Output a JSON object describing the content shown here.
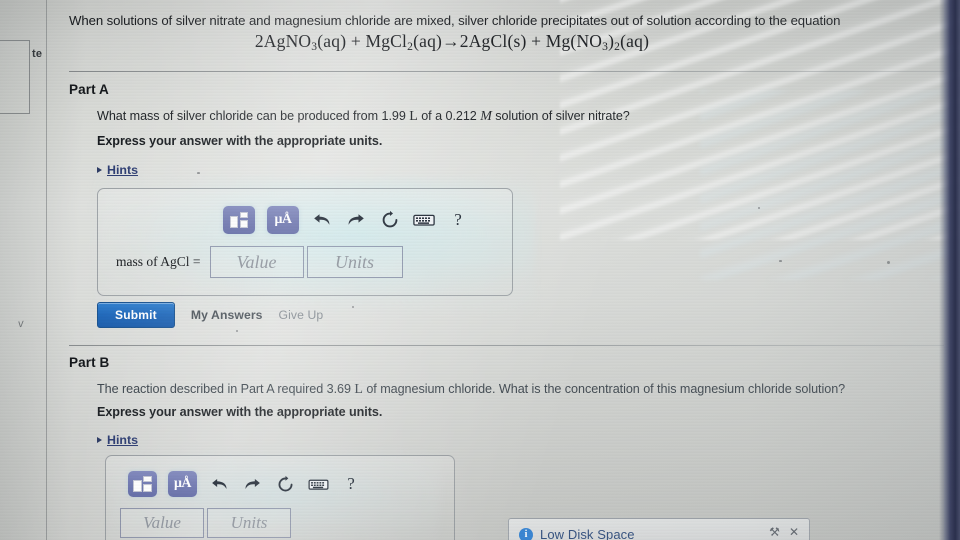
{
  "sidebar": {
    "fragment_label": "te",
    "scribble": "v"
  },
  "problem": {
    "prompt": "When solutions of silver nitrate and magnesium chloride are mixed, silver chloride precipitates out of solution according to the equation",
    "equation_plain": "2AgNO3(aq) + MgCl2(aq)→2AgCl(s) + Mg(NO3)2(aq)",
    "equation_parts": {
      "t1": "2AgNO",
      "s1": "3",
      "t2": "(aq) + MgCl",
      "s2": "2",
      "t3": "(aq)→2AgCl(s) + Mg(NO",
      "s3": "3",
      "t4": ")",
      "s4": "2",
      "t5": "(aq)"
    }
  },
  "part_a": {
    "heading": "Part A",
    "question_prefix": "What mass of silver chloride can be produced from ",
    "volume": "1.99",
    "volume_unit": "L",
    "question_mid": " of a ",
    "concentration": "0.212",
    "concentration_unit": "M",
    "question_suffix": " solution of silver nitrate?",
    "instruction": "Express your answer with the appropriate units.",
    "hints_label": "Hints",
    "answer_label": "mass of AgCl =",
    "value_placeholder": "Value",
    "units_placeholder": "Units",
    "toolbar": {
      "template_tooltip": "template",
      "units_glyph": "μÅ",
      "undo": "undo",
      "redo": "redo",
      "reset": "reset",
      "keyboard": "keyboard",
      "help": "?"
    },
    "submit_label": "Submit",
    "my_answers_label": "My Answers",
    "give_up_label": "Give Up"
  },
  "part_b": {
    "heading": "Part B",
    "question_prefix": "The reaction described in Part A required ",
    "volume": "3.69",
    "volume_unit": "L",
    "question_suffix": " of magnesium chloride. What is the concentration of this magnesium chloride solution?",
    "instruction": "Express your answer with the appropriate units.",
    "hints_label": "Hints",
    "value_placeholder": "Value",
    "units_placeholder": "Units",
    "toolbar": {
      "units_glyph": "μÅ",
      "help": "?"
    }
  },
  "notification": {
    "info_glyph": "i",
    "title": "Low Disk Space",
    "settings_glyph": "⚒",
    "close_glyph": "✕"
  },
  "colors": {
    "accent_blue": "#1f68bb",
    "link_blue": "#2a3a70",
    "toolbar_purple": "#6b74ae",
    "notif_blue": "#2f7fd0",
    "bezel_navy": "#343a5c"
  }
}
